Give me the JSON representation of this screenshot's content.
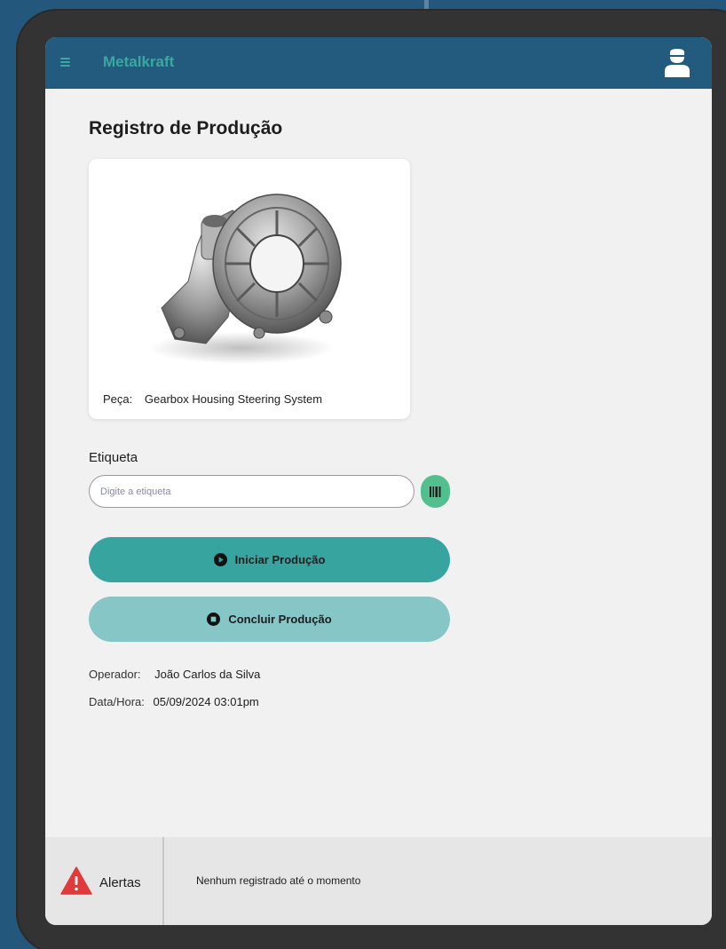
{
  "app": {
    "brand": "Metalkraft"
  },
  "page": {
    "title": "Registro de Produção"
  },
  "part": {
    "label": "Peça:",
    "name": "Gearbox Housing Steering System"
  },
  "tag": {
    "label": "Etiqueta",
    "placeholder": "Digite a etiqueta",
    "value": ""
  },
  "actions": {
    "start_label": "Iniciar Produção",
    "finish_label": "Concluir Produção"
  },
  "info": {
    "operator_label": "Operador:",
    "operator_value": "João Carlos da Silva",
    "datetime_label": "Data/Hora:",
    "datetime_value": "05/09/2024 03:01pm"
  },
  "alerts": {
    "title": "Alertas",
    "message": "Nenhum registrado até o momento"
  },
  "icons": {
    "menu": "menu-icon",
    "user": "user-icon",
    "barcode": "barcode-icon",
    "start": "play-circle-icon",
    "finish": "stop-circle-icon",
    "alert": "warning-triangle-icon"
  },
  "colors": {
    "background": "#23577b",
    "appbar": "#235b7e",
    "brand_accent": "#3ba7a2",
    "start_button": "#38a4a0",
    "finish_button": "#86c6c6",
    "scan_button": "#52c08e",
    "alert": "#e03a3a"
  }
}
